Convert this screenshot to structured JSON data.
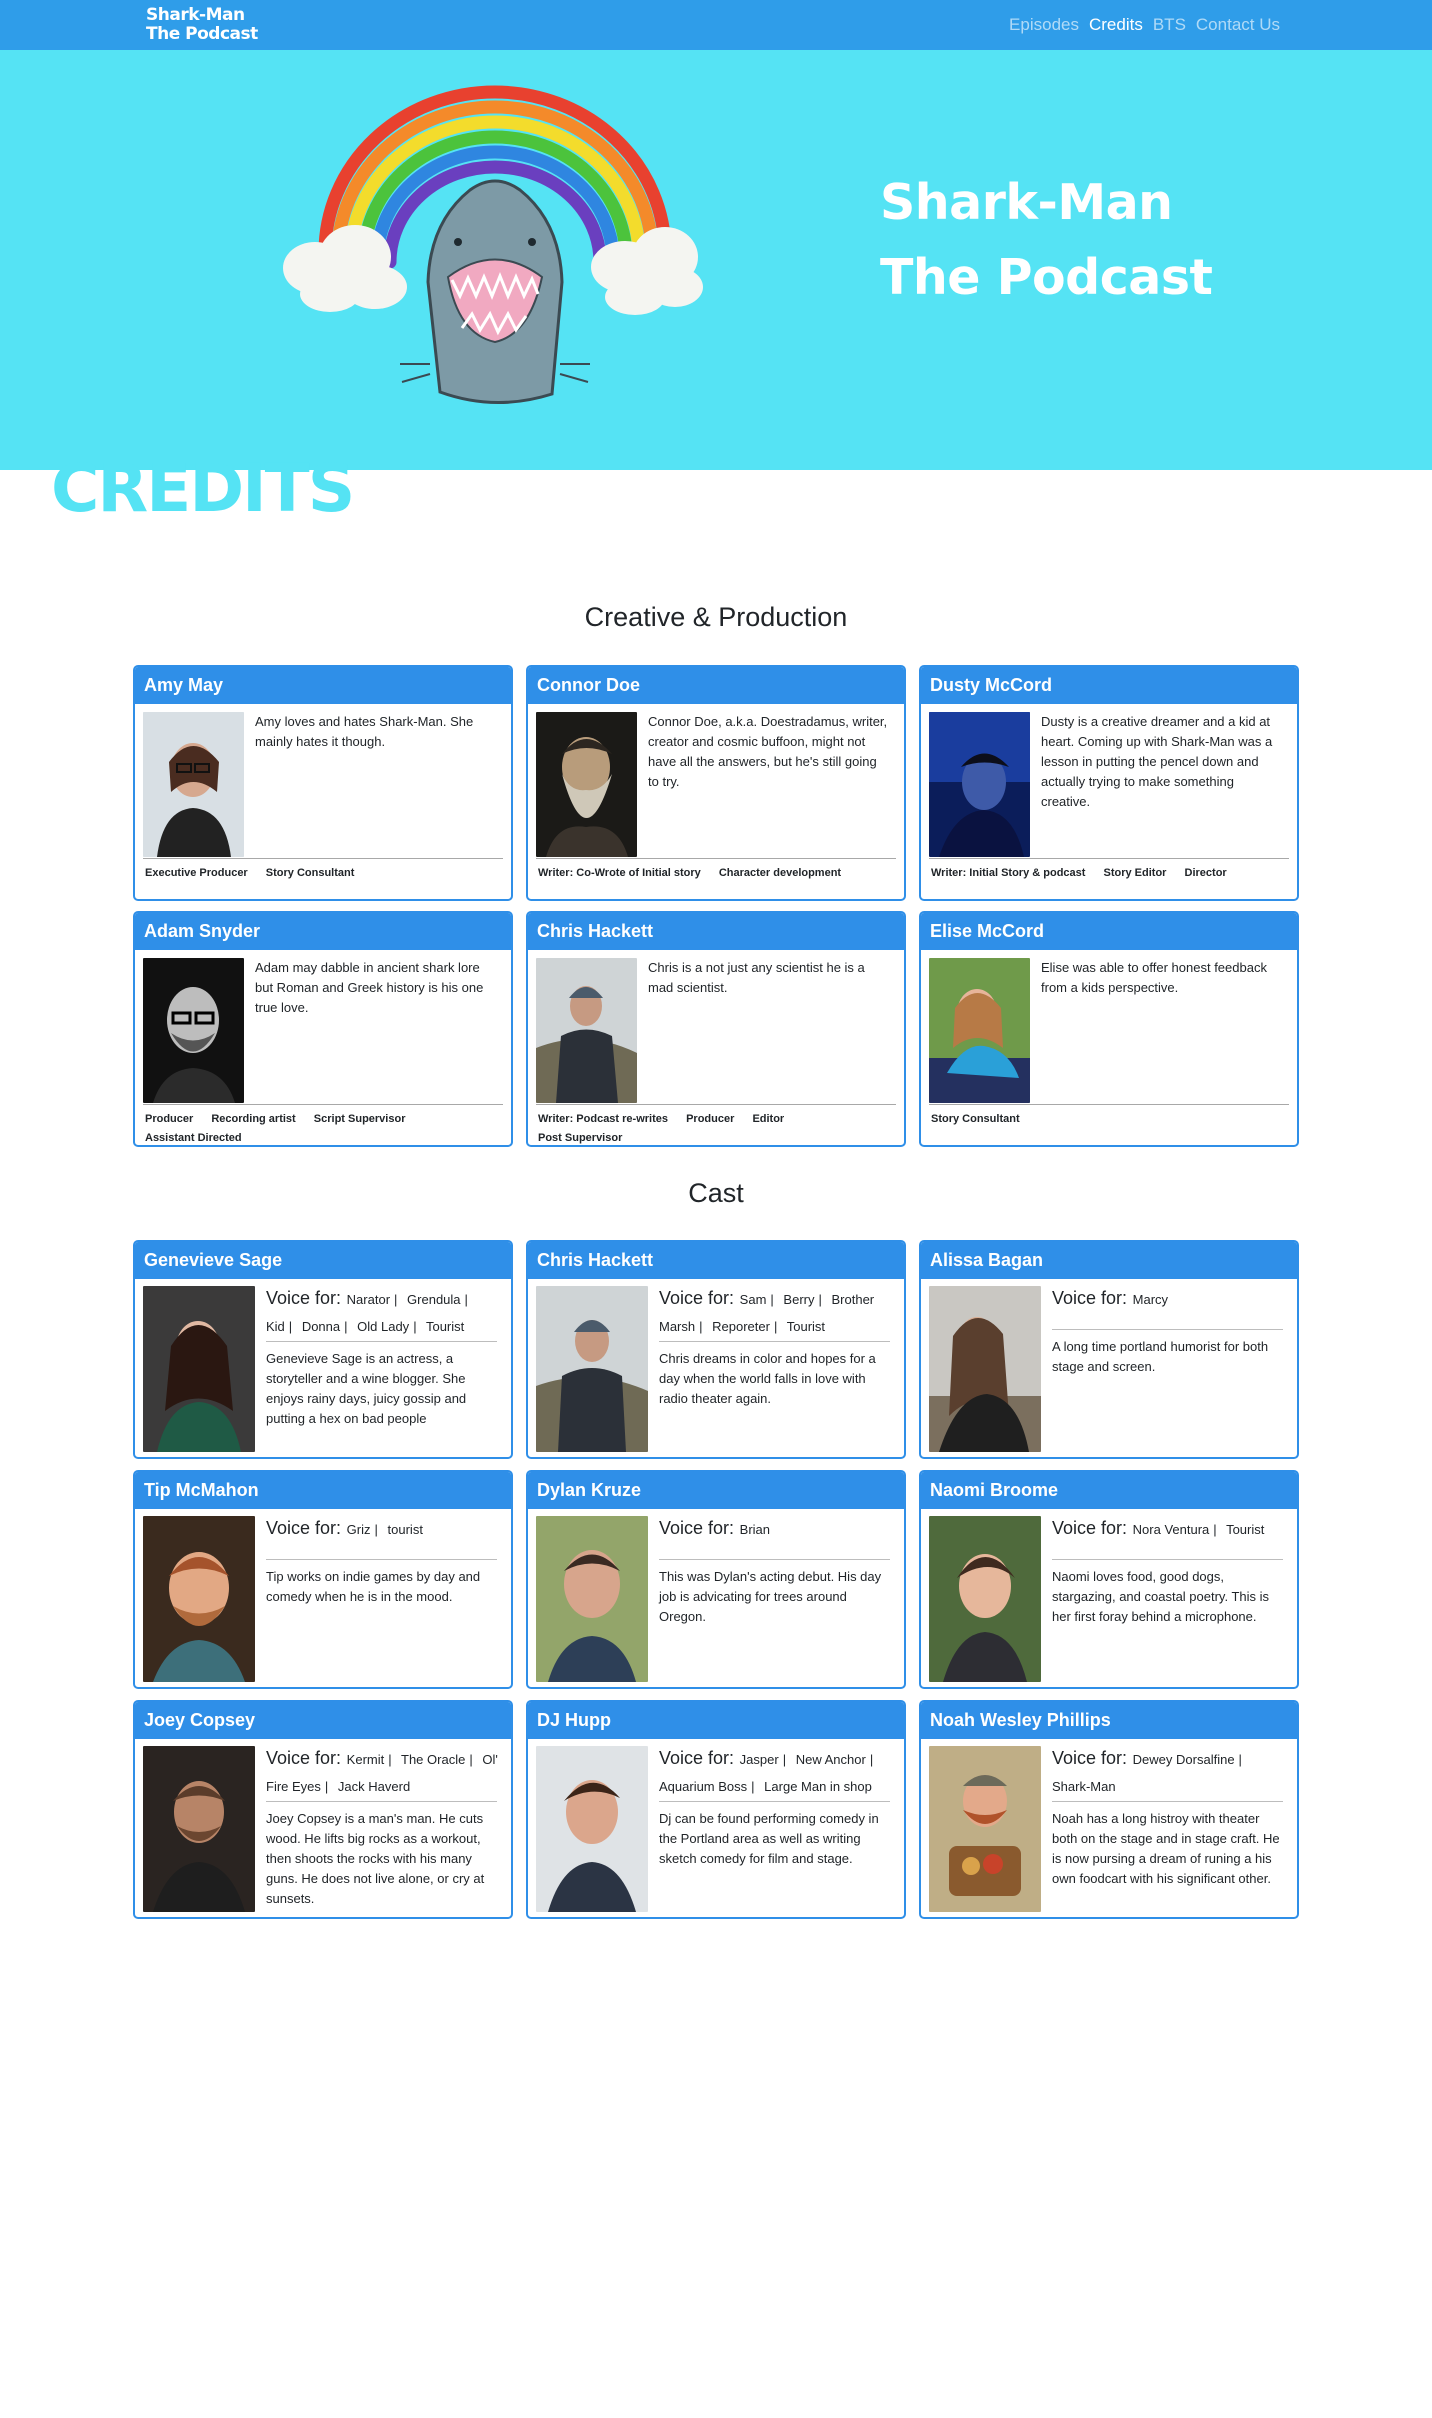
{
  "nav": {
    "brand_line1": "Shark-Man",
    "brand_line2": "The Podcast",
    "links": [
      "Episodes",
      "Credits",
      "BTS",
      "Contact Us"
    ],
    "active": "Credits"
  },
  "hero": {
    "title_line1": "Shark-Man",
    "title_line2": "The Podcast"
  },
  "page_heading": "CREDITS",
  "creative": {
    "title": "Creative & Production",
    "people": [
      {
        "name": "Amy May",
        "bio": "Amy loves and hates Shark-Man. She mainly hates it though.",
        "roles": [
          "Executive Producer",
          "Story Consultant"
        ]
      },
      {
        "name": "Connor Doe",
        "bio": "Connor Doe, a.k.a. Doestradamus, writer, creator and cosmic buffoon, might not have all the answers, but he's still going to try.",
        "roles": [
          "Writer: Co-Wrote of Initial story",
          "Character development"
        ]
      },
      {
        "name": "Dusty McCord",
        "bio": "Dusty is a creative dreamer and a kid at heart. Coming up with Shark-Man was a lesson in putting the pencel down and actually trying to make something creative.",
        "roles": [
          "Writer: Initial Story & podcast",
          "Story Editor",
          "Director"
        ]
      },
      {
        "name": "Adam Snyder",
        "bio": "Adam may dabble in ancient shark lore but Roman and Greek history is his one true love.",
        "roles": [
          "Producer",
          "Recording artist",
          "Script Supervisor",
          "Assistant Directed"
        ]
      },
      {
        "name": "Chris Hackett",
        "bio": "Chris is a not just any scientist he is a mad scientist.",
        "roles": [
          "Writer: Podcast re-writes",
          "Producer",
          "Editor",
          "Post Supervisor"
        ]
      },
      {
        "name": "Elise McCord",
        "bio": "Elise was able to offer honest feedback from a kids perspective.",
        "roles": [
          "Story Consultant"
        ]
      }
    ]
  },
  "cast": {
    "title": "Cast",
    "voice_label": "Voice for:",
    "people": [
      {
        "name": "Genevieve Sage",
        "roles": [
          "Narator",
          "Grendula",
          "Kid",
          "Donna",
          "Old Lady",
          "Tourist"
        ],
        "bio": "Genevieve Sage is an actress, a storyteller and a wine blogger. She enjoys rainy days, juicy gossip and putting a hex on bad people"
      },
      {
        "name": "Chris Hackett",
        "roles": [
          "Sam",
          "Berry",
          "Brother Marsh",
          "Reporeter",
          "Tourist"
        ],
        "bio": "Chris dreams in color and hopes for a day when the world falls in love with radio theater again."
      },
      {
        "name": "Alissa Bagan",
        "roles": [
          "Marcy"
        ],
        "bio": "A long time portland humorist for both stage and screen."
      },
      {
        "name": "Tip McMahon",
        "roles": [
          "Griz",
          "tourist"
        ],
        "bio": "Tip works on indie games by day and comedy when he is in the mood."
      },
      {
        "name": "Dylan Kruze",
        "roles": [
          "Brian"
        ],
        "bio": "This was Dylan's acting debut. His day job is advicating for trees around Oregon."
      },
      {
        "name": "Naomi Broome",
        "roles": [
          "Nora Ventura",
          "Tourist"
        ],
        "bio": "Naomi loves food, good dogs, stargazing, and coastal poetry. This is her first foray behind a microphone."
      },
      {
        "name": "Joey Copsey",
        "roles": [
          "Kermit",
          "The Oracle",
          "Ol' Fire Eyes",
          "Jack Haverd"
        ],
        "bio": "Joey Copsey is a man's man. He cuts wood. He lifts big rocks as a workout, then shoots the rocks with his many guns. He does not live alone, or cry at sunsets."
      },
      {
        "name": "DJ Hupp",
        "roles": [
          "Jasper",
          "New Anchor",
          "Aquarium Boss",
          "Large Man in shop"
        ],
        "bio": "Dj can be found performing comedy in the Portland area as well as writing sketch comedy for film and stage."
      },
      {
        "name": "Noah Wesley Phillips",
        "roles": [
          "Dewey Dorsalfine",
          "Shark-Man"
        ],
        "bio": "Noah has a long histroy with theater both on the stage and in stage craft. He is now pursing a dream of runing a his own foodcart with his significant other."
      }
    ]
  },
  "colors": {
    "nav": "#2f9de9",
    "hero": "#55e3f4",
    "card_accent": "#2f8fe8"
  }
}
